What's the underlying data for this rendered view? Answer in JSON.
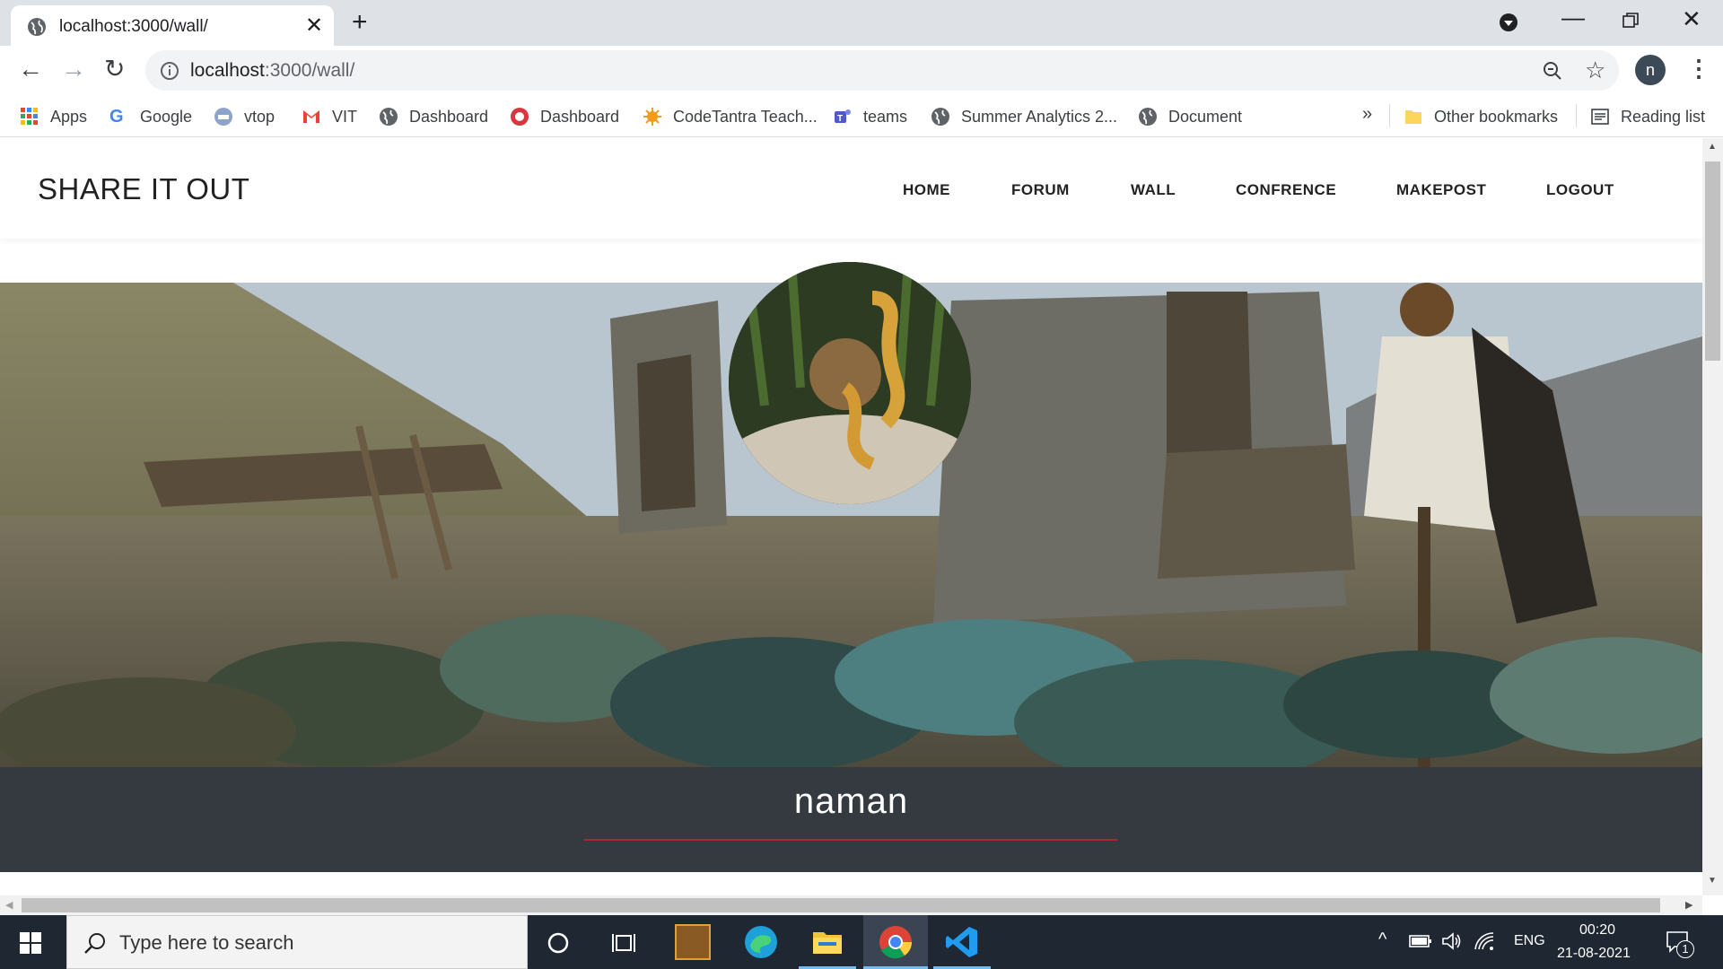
{
  "browser": {
    "tab_title": "localhost:3000/wall/",
    "url_host": "localhost",
    "url_rest": ":3000/wall/",
    "profile_initial": "n",
    "bookmarks": [
      {
        "label": "Apps",
        "icon": "apps-grid-icon"
      },
      {
        "label": "Google",
        "icon": "google-icon"
      },
      {
        "label": "vtop",
        "icon": "vtop-icon"
      },
      {
        "label": "VIT",
        "icon": "gmail-icon"
      },
      {
        "label": "Dashboard",
        "icon": "globe-icon"
      },
      {
        "label": "Dashboard",
        "icon": "dashboard-badge-icon"
      },
      {
        "label": "CodeTantra Teach...",
        "icon": "codetantra-icon"
      },
      {
        "label": "teams",
        "icon": "teams-icon"
      },
      {
        "label": "Summer Analytics 2...",
        "icon": "globe-icon"
      },
      {
        "label": "Document",
        "icon": "globe-icon"
      }
    ],
    "overflow_label": "»",
    "other_bookmarks": "Other bookmarks",
    "reading_list": "Reading list"
  },
  "site": {
    "brand": "SHARE IT OUT",
    "nav": [
      "HOME",
      "FORUM",
      "WALL",
      "CONFRENCE",
      "MAKEPOST",
      "LOGOUT"
    ]
  },
  "profile": {
    "name": "naman"
  },
  "taskbar": {
    "search_placeholder": "Type here to search",
    "lang": "ENG",
    "time": "00:20",
    "date": "21-08-2021",
    "notification_count": "1"
  },
  "colors": {
    "tabbar": "#dee1e6",
    "profile_band": "#343a40",
    "divider": "#b3242c",
    "taskbar": "#1f2733"
  }
}
